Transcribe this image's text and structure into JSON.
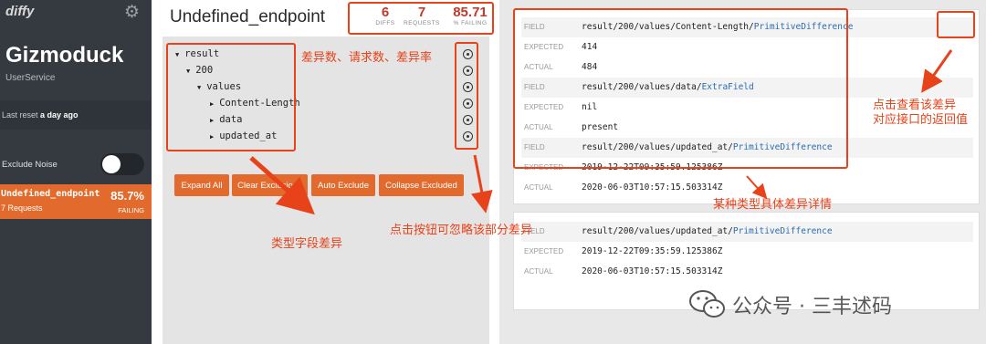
{
  "sidebar": {
    "logo": "diffy",
    "service_name": "Gizmoduck",
    "service_sub": "UserService",
    "reset_prefix": "Last reset ",
    "reset_value": "a day ago",
    "exclude_noise": "Exclude Noise",
    "endpoint": {
      "name": "Undefined_endpoint",
      "requests": "7 Requests",
      "percent": "85.7%",
      "status": "FAILING"
    }
  },
  "header": {
    "title": "Undefined_endpoint",
    "diffs": "6",
    "diffs_label": "DIFFS",
    "requests": "7",
    "requests_label": "REQUESTS",
    "failing": "85.71",
    "failing_label": "% FAILING"
  },
  "tree": [
    {
      "label": "result",
      "indent": 0,
      "open": true
    },
    {
      "label": "200",
      "indent": 1,
      "open": true
    },
    {
      "label": "values",
      "indent": 2,
      "open": true
    },
    {
      "label": "Content-Length",
      "indent": 3,
      "open": false
    },
    {
      "label": "data",
      "indent": 3,
      "open": false
    },
    {
      "label": "updated_at",
      "indent": 3,
      "open": false
    }
  ],
  "buttons": {
    "expand_all": "Expand All",
    "clear_exclusions": "Clear Exclusions",
    "auto_exclude": "Auto Exclude",
    "collapse_excluded": "Collapse Excluded"
  },
  "card1": {
    "rows": [
      {
        "k": "FIELD",
        "v": "result/200/values/Content-Length/",
        "hl": "PrimitiveDifference"
      },
      {
        "k": "EXPECTED",
        "v": "414",
        "hl": ""
      },
      {
        "k": "ACTUAL",
        "v": "484",
        "hl": ""
      },
      {
        "k": "FIELD",
        "v": "result/200/values/data/",
        "hl": "ExtraField"
      },
      {
        "k": "EXPECTED",
        "v": "nil",
        "hl": ""
      },
      {
        "k": "ACTUAL",
        "v": "present",
        "hl": ""
      },
      {
        "k": "FIELD",
        "v": "result/200/values/updated_at/",
        "hl": "PrimitiveDifference"
      },
      {
        "k": "EXPECTED",
        "v": "2019-12-22T09:35:59.125386Z",
        "hl": ""
      },
      {
        "k": "ACTUAL",
        "v": "2020-06-03T10:57:15.503314Z",
        "hl": ""
      }
    ]
  },
  "card2": {
    "rows": [
      {
        "k": "FIELD",
        "v": "result/200/values/updated_at/",
        "hl": "PrimitiveDifference"
      },
      {
        "k": "EXPECTED",
        "v": "2019-12-22T09:35:59.125386Z",
        "hl": ""
      },
      {
        "k": "ACTUAL",
        "v": "2020-06-03T10:57:15.503314Z",
        "hl": ""
      }
    ]
  },
  "annotations": {
    "stats": "差异数、请求数、差异率",
    "fields": "类型字段差异",
    "ignore": "点击按钮可忽略该部分差异",
    "view_line1": "点击查看该差异",
    "view_line2": "对应接口的返回值",
    "detail": "某种类型具体差异详情"
  },
  "watermark": "公众号 · 三丰述码",
  "colors": {
    "accent": "#e26a2c",
    "annotation": "#e8421a",
    "sidebar": "#353a40"
  }
}
